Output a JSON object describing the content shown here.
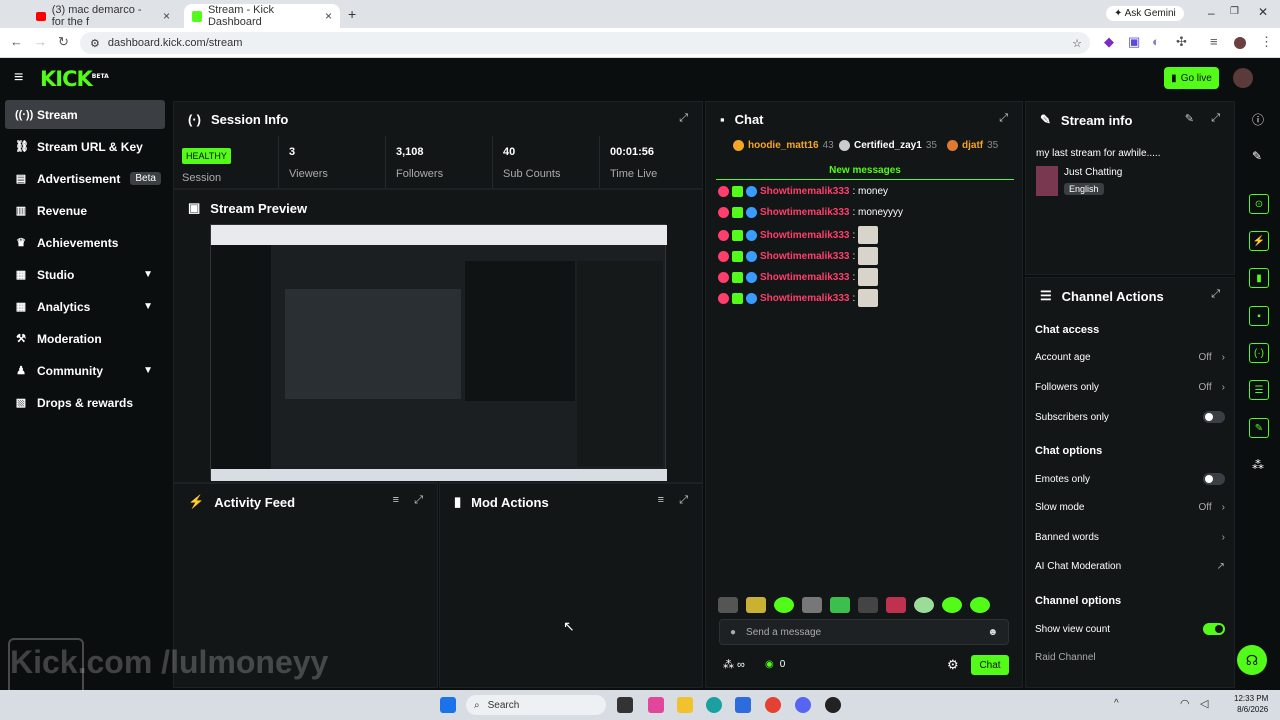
{
  "browser": {
    "tabs": [
      {
        "title": "(3) mac demarco - for the f",
        "active": false
      },
      {
        "title": "Stream - Kick Dashboard",
        "active": true
      }
    ],
    "url": "dashboard.kick.com/stream",
    "ask_gemini": "Ask Gemini"
  },
  "header": {
    "logo": "KICK",
    "logo_badge": "BETA",
    "go_live": "Go live"
  },
  "sidebar": {
    "items": [
      {
        "label": "Stream",
        "icon": "broadcast-icon"
      },
      {
        "label": "Stream URL & Key",
        "icon": "link-icon"
      },
      {
        "label": "Advertisement",
        "icon": "ad-icon",
        "badge": "Beta"
      },
      {
        "label": "Revenue",
        "icon": "chart-icon"
      },
      {
        "label": "Achievements",
        "icon": "trophy-icon"
      },
      {
        "label": "Studio",
        "icon": "studio-icon"
      },
      {
        "label": "Analytics",
        "icon": "analytics-icon"
      },
      {
        "label": "Moderation",
        "icon": "hammer-icon"
      },
      {
        "label": "Community",
        "icon": "community-icon"
      },
      {
        "label": "Drops & rewards",
        "icon": "gift-icon"
      }
    ]
  },
  "session_info": {
    "title": "Session Info",
    "health": "HEALTHY",
    "health_label": "Session",
    "stats": [
      {
        "value": "3",
        "label": "Viewers"
      },
      {
        "value": "3,108",
        "label": "Followers"
      },
      {
        "value": "40",
        "label": "Sub Counts"
      },
      {
        "value": "00:01:56",
        "label": "Time Live"
      }
    ]
  },
  "stream_preview": {
    "title": "Stream Preview"
  },
  "watermark": "Kick.com /lulmoneyy",
  "activity_feed": {
    "title": "Activity Feed"
  },
  "mod_actions": {
    "title": "Mod Actions"
  },
  "chat": {
    "title": "Chat",
    "top_chatters": [
      {
        "name": "hoodie_matt16",
        "count": "43"
      },
      {
        "name": "Certified_zay1",
        "count": "35"
      },
      {
        "name": "djatf",
        "count": "35"
      }
    ],
    "new_messages": "New messages",
    "messages": [
      {
        "user": "Showtimemalik333",
        "text": ": money"
      },
      {
        "user": "Showtimemalik333",
        "text": ": moneyyyy"
      },
      {
        "user": "Showtimemalik333",
        "text": ":"
      },
      {
        "user": "Showtimemalik333",
        "text": ":"
      },
      {
        "user": "Showtimemalik333",
        "text": ":"
      },
      {
        "user": "Showtimemalik333",
        "text": ":"
      }
    ],
    "placeholder": "Send a message",
    "points": "0",
    "send": "Chat"
  },
  "stream_info": {
    "title": "Stream info",
    "stream_title": "my last stream for awhile.....",
    "category": "Just Chatting",
    "language": "English"
  },
  "channel_actions": {
    "title": "Channel Actions",
    "chat_access": "Chat access",
    "account_age": "Account age",
    "account_age_value": "Off",
    "followers_only": "Followers only",
    "followers_only_value": "Off",
    "subscribers_only": "Subscribers only",
    "chat_options": "Chat options",
    "emotes_only": "Emotes only",
    "slow_mode": "Slow mode",
    "slow_mode_value": "Off",
    "banned_words": "Banned words",
    "ai_moderation": "AI Chat Moderation",
    "channel_options": "Channel options",
    "show_view_count": "Show view count",
    "raid_channel": "Raid Channel"
  },
  "taskbar": {
    "search": "Search",
    "time": "12:33 PM",
    "date": "8/6/2026"
  },
  "colors": {
    "accent": "#53fc18",
    "chat_user": "#ff3e6c",
    "panel": "#131617"
  }
}
